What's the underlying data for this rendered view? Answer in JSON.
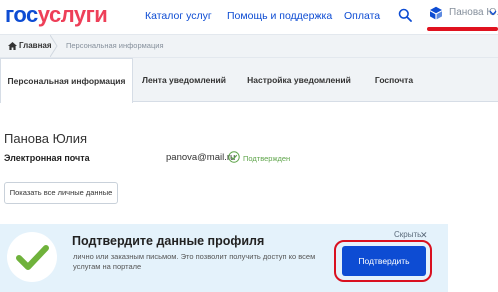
{
  "header": {
    "logo_part1": "гос",
    "logo_part2": "услуги",
    "nav": [
      "Каталог услуг",
      "Помощь и поддержка",
      "Оплата"
    ],
    "user_name": "Панова Ю.",
    "icons": [
      "search-icon",
      "user-icon",
      "chevron-down-icon"
    ]
  },
  "breadcrumb": {
    "home": "Главная",
    "current": "Персональная информация"
  },
  "tabs": [
    "Персональная информация",
    "Лента уведомлений",
    "Настройка уведомлений",
    "Госпочта"
  ],
  "profile": {
    "name": "Панова Юлия",
    "email_label": "Электронная почта",
    "email_value": "panova@mail.ru",
    "verified": "Подтвержден",
    "show_all_button": "Показать все личные данные"
  },
  "banner": {
    "title": "Подтвердите данные профиля",
    "text": "лично или заказным письмом. Это позволит получить доступ ко всем услугам на портале",
    "hide": "Скрыть",
    "close": "✕",
    "confirm_button": "Подтвердить"
  },
  "colors": {
    "brand_blue": "#0d4cd3",
    "brand_red": "#ee3f58",
    "highlight_red": "#d9101f",
    "verified_green": "#5fa54b",
    "banner_bg": "#e4f2fb"
  }
}
